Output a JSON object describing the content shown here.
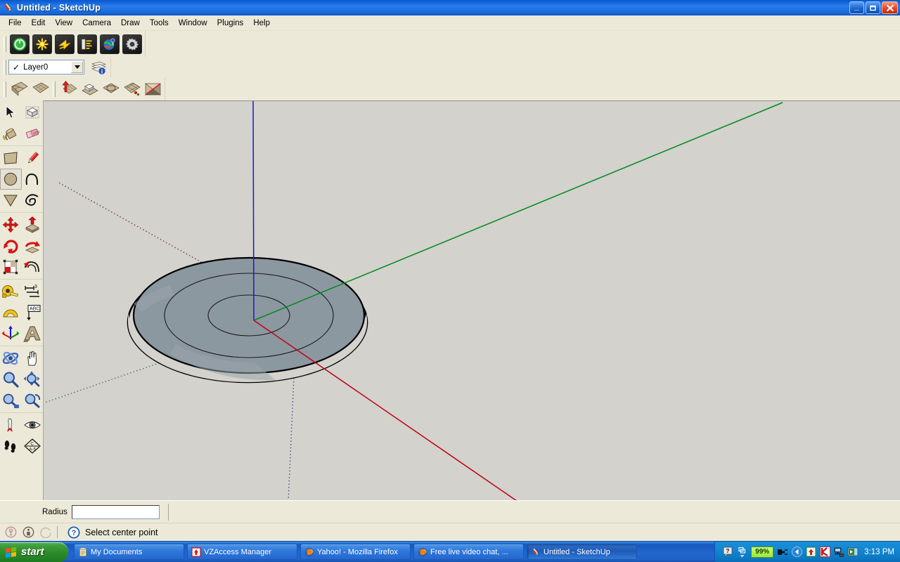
{
  "window": {
    "title": "Untitled - SketchUp",
    "app_icon": "sketchup-pencil-icon",
    "buttons": {
      "minimize": "_",
      "maximize": "□",
      "close": "✕"
    }
  },
  "menubar": {
    "items": [
      "File",
      "Edit",
      "View",
      "Camera",
      "Draw",
      "Tools",
      "Window",
      "Plugins",
      "Help"
    ]
  },
  "toolbars": {
    "google_row": [
      {
        "name": "get-models-button",
        "icon": "power-green-icon"
      },
      {
        "name": "share-model-button",
        "icon": "yellow-star-burst-icon"
      },
      {
        "name": "share-component-button",
        "icon": "yellow-arrow-burst-icon"
      },
      {
        "name": "document-info-button",
        "icon": "panel-burst-icon"
      },
      {
        "name": "preview-model-in-google-earth-button",
        "icon": "earth-pin-icon"
      },
      {
        "name": "settings-button",
        "icon": "gear-icon"
      }
    ],
    "layers": {
      "current_layer": "Layer0",
      "checked": "✓",
      "dropdown_arrow": "▼",
      "layer_manager_button": "layers-info-icon"
    },
    "sandbox_row": [
      {
        "name": "sandbox-from-contours-button",
        "icon": "terrain-contours-icon"
      },
      {
        "name": "sandbox-from-scratch-button",
        "icon": "terrain-grid-icon"
      },
      {
        "name": "smoove-button",
        "icon": "smoove-red-arrow-icon"
      },
      {
        "name": "stamp-button",
        "icon": "stamp-icon"
      },
      {
        "name": "drape-button",
        "icon": "drape-circle-icon"
      },
      {
        "name": "add-detail-button",
        "icon": "add-detail-icon"
      },
      {
        "name": "flip-edge-button",
        "icon": "flip-edge-icon"
      }
    ]
  },
  "left_palette": {
    "sections": [
      {
        "name": "principal",
        "rows": [
          [
            {
              "name": "select-tool",
              "icon": "arrow-cursor-icon",
              "active": false
            },
            {
              "name": "make-component-tool",
              "icon": "component-box-icon",
              "active": false
            }
          ],
          [
            {
              "name": "paint-bucket-tool",
              "icon": "paint-bucket-icon",
              "active": false
            },
            {
              "name": "eraser-tool",
              "icon": "eraser-icon",
              "active": false
            }
          ]
        ]
      },
      {
        "name": "drawing",
        "rows": [
          [
            {
              "name": "rectangle-tool",
              "icon": "rectangle-icon",
              "active": false
            },
            {
              "name": "line-tool",
              "icon": "pencil-line-icon",
              "active": false
            }
          ],
          [
            {
              "name": "circle-tool",
              "icon": "circle-icon",
              "active": true
            },
            {
              "name": "arc-tool",
              "icon": "arc-icon",
              "active": false
            }
          ],
          [
            {
              "name": "polygon-tool",
              "icon": "polygon-triangle-icon",
              "active": false
            },
            {
              "name": "freehand-tool",
              "icon": "freehand-squiggle-icon",
              "active": false
            }
          ]
        ]
      },
      {
        "name": "modification",
        "rows": [
          [
            {
              "name": "move-tool",
              "icon": "move-cross-arrows-icon",
              "active": false
            },
            {
              "name": "push-pull-tool",
              "icon": "push-pull-icon",
              "active": false
            }
          ],
          [
            {
              "name": "rotate-tool",
              "icon": "rotate-icon",
              "active": false
            },
            {
              "name": "follow-me-tool",
              "icon": "follow-me-icon",
              "active": false
            }
          ],
          [
            {
              "name": "scale-tool",
              "icon": "scale-icon",
              "active": false
            },
            {
              "name": "offset-tool",
              "icon": "offset-icon",
              "active": false
            }
          ]
        ]
      },
      {
        "name": "construction",
        "rows": [
          [
            {
              "name": "tape-measure-tool",
              "icon": "tape-measure-icon",
              "active": false
            },
            {
              "name": "dimension-tool",
              "icon": "dimension-icon",
              "active": false
            }
          ],
          [
            {
              "name": "protractor-tool",
              "icon": "protractor-icon",
              "active": false
            },
            {
              "name": "text-tool",
              "icon": "abc-text-icon",
              "active": false
            }
          ],
          [
            {
              "name": "axes-tool",
              "icon": "axes-icon",
              "active": false
            },
            {
              "name": "3d-text-tool",
              "icon": "3d-text-icon",
              "active": false
            }
          ]
        ]
      },
      {
        "name": "camera",
        "rows": [
          [
            {
              "name": "orbit-tool",
              "icon": "orbit-icon",
              "active": false
            },
            {
              "name": "pan-tool",
              "icon": "hand-pan-icon",
              "active": false
            }
          ],
          [
            {
              "name": "zoom-tool",
              "icon": "magnifier-icon",
              "active": false
            },
            {
              "name": "zoom-window-tool",
              "icon": "zoom-window-icon",
              "active": false
            }
          ],
          [
            {
              "name": "zoom-extents-tool",
              "icon": "zoom-extents-icon",
              "active": false
            },
            {
              "name": "previous-view-tool",
              "icon": "previous-view-icon",
              "active": false
            }
          ]
        ]
      },
      {
        "name": "walkthrough",
        "rows": [
          [
            {
              "name": "position-camera-tool",
              "icon": "position-camera-icon",
              "active": false
            },
            {
              "name": "look-around-tool",
              "icon": "eye-look-around-icon",
              "active": false
            }
          ],
          [
            {
              "name": "walk-tool",
              "icon": "footsteps-walk-icon",
              "active": false
            },
            {
              "name": "section-plane-tool",
              "icon": "section-plane-icon",
              "active": false
            }
          ]
        ]
      }
    ]
  },
  "viewport": {
    "background_color": "#d3d2cd",
    "face_color": "#8c98a0",
    "axes": {
      "red_positive_color": "#c00014",
      "red_negative_color": "#7a3a42",
      "green_positive_color": "#008a1e",
      "green_negative_color": "#4e7a50",
      "blue_positive_color": "#1a1acc",
      "blue_negative_color": "#4a4a8c"
    },
    "model_description": "Circle / disc geometry with concentric circles drawn on ground plane"
  },
  "measurement": {
    "label": "Radius",
    "value": "",
    "placeholder": ""
  },
  "statusbar": {
    "icons": [
      "geo-location-icon",
      "credits-person-icon",
      "claim-icon"
    ],
    "help_icon": "question-help-icon",
    "message": "Select center point"
  },
  "taskbar": {
    "start_label": "start",
    "start_icon": "windows-flag-icon",
    "items": [
      {
        "name": "taskbar-item-my-documents",
        "label": "My Documents",
        "icon": "folder-documents-icon",
        "active": false
      },
      {
        "name": "taskbar-item-vzaccess",
        "label": "VZAccess Manager",
        "icon": "vzaccess-icon",
        "active": false
      },
      {
        "name": "taskbar-item-yahoo-firefox",
        "label": "Yahoo! - Mozilla Firefox",
        "icon": "firefox-icon",
        "active": false
      },
      {
        "name": "taskbar-item-video-chat",
        "label": "Free live video chat, ...",
        "icon": "firefox-icon",
        "active": false
      },
      {
        "name": "taskbar-item-sketchup",
        "label": "Untitled - SketchUp",
        "icon": "sketchup-pencil-icon",
        "active": true
      }
    ],
    "tray": {
      "battery_percent": "99%",
      "clock": "3:13 PM",
      "icons": [
        "help-balloon-icon",
        "show-hidden-icons-icon",
        "power-plug-icon",
        "chevron-left-icon",
        "update-shield-icon",
        "kaspersky-k-icon",
        "network-computers-icon",
        "display-monitor-icon"
      ]
    }
  }
}
